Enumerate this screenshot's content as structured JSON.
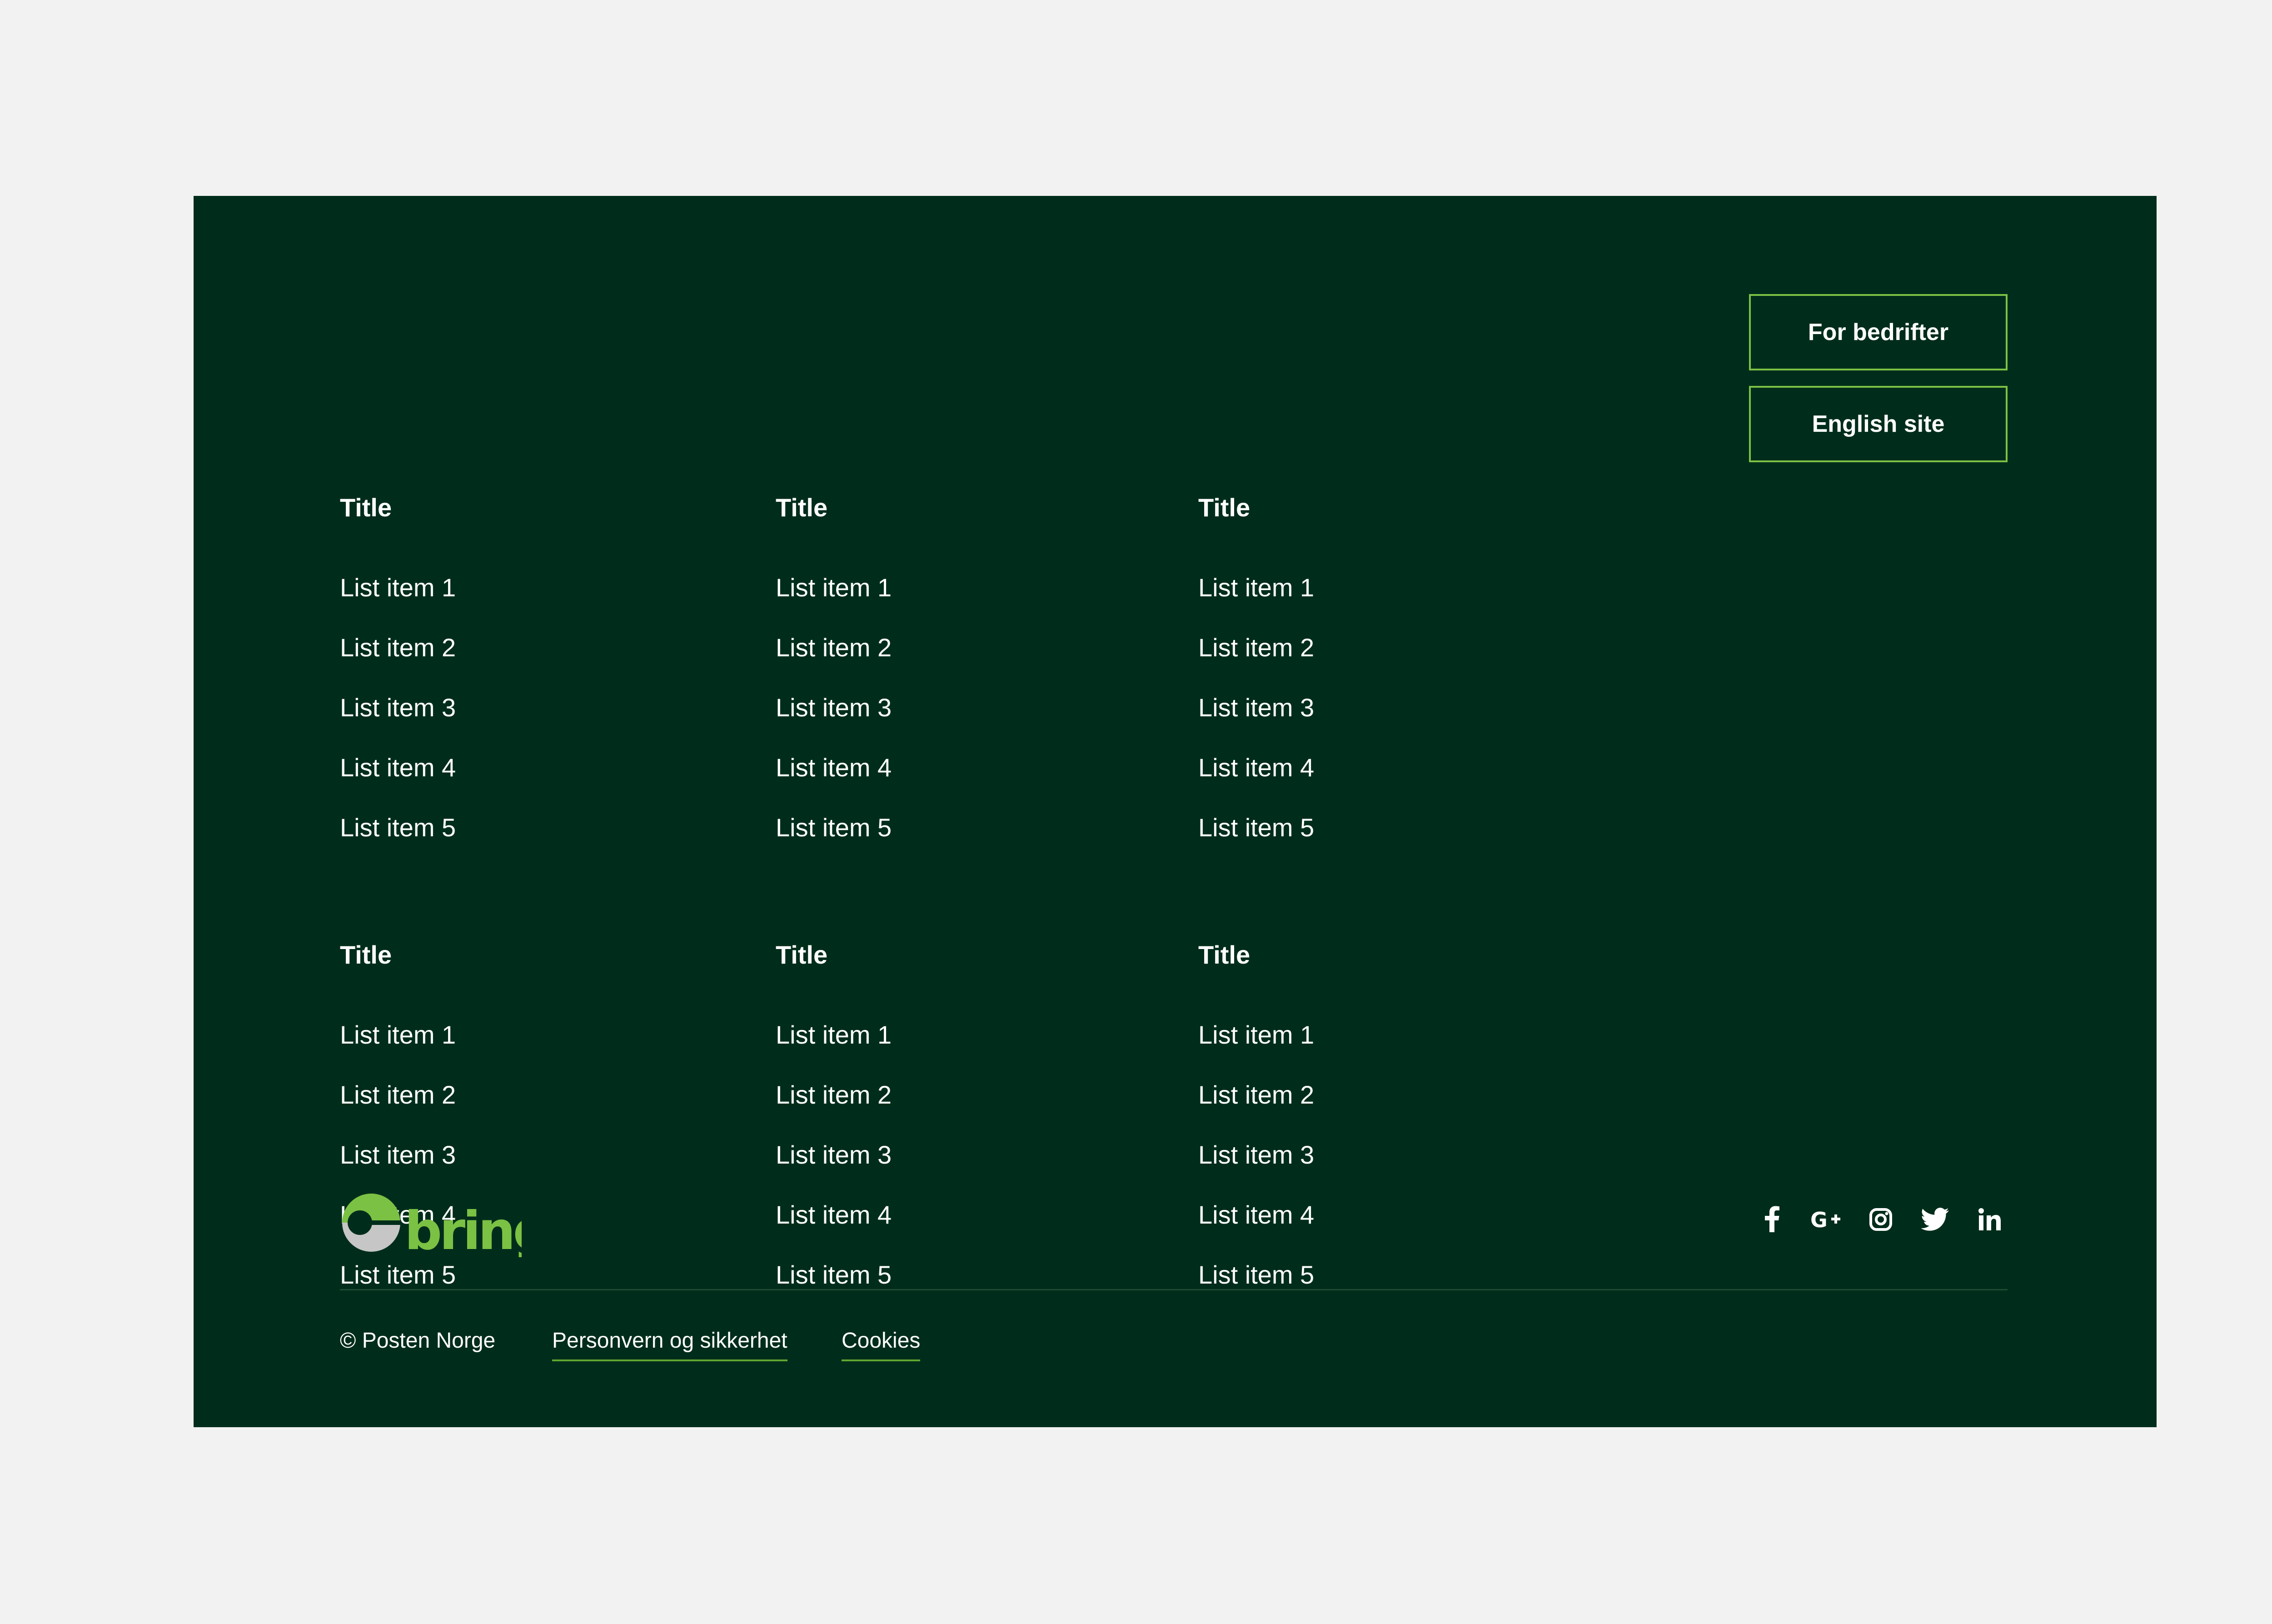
{
  "footer": {
    "sections": [
      {
        "columns": [
          {
            "title": "Title",
            "items": [
              "List item 1",
              "List item 2",
              "List item 3",
              "List item 4",
              "List item 5"
            ]
          },
          {
            "title": "Title",
            "items": [
              "List item 1",
              "List item 2",
              "List item 3",
              "List item 4",
              "List item 5"
            ]
          },
          {
            "title": "Title",
            "items": [
              "List item 1",
              "List item 2",
              "List item 3",
              "List item 4",
              "List item 5"
            ]
          }
        ]
      },
      {
        "columns": [
          {
            "title": "Title",
            "items": [
              "List item 1",
              "List item 2",
              "List item 3",
              "List item 4",
              "List item 5"
            ]
          },
          {
            "title": "Title",
            "items": [
              "List item 1",
              "List item 2",
              "List item 3",
              "List item 4",
              "List item 5"
            ]
          },
          {
            "title": "Title",
            "items": [
              "List item 1",
              "List item 2",
              "List item 3",
              "List item 4",
              "List item 5"
            ]
          }
        ]
      }
    ],
    "buttons": {
      "business_label": "For bedrifter",
      "english_label": "English site"
    },
    "logo": {
      "text": "bring",
      "icon": "bring-logo-icon"
    },
    "social": [
      {
        "name": "facebook-icon"
      },
      {
        "name": "google-plus-icon"
      },
      {
        "name": "instagram-icon"
      },
      {
        "name": "twitter-icon"
      },
      {
        "name": "linkedin-icon"
      }
    ],
    "bottom": {
      "copyright": "© Posten Norge",
      "privacy_link": "Personvern og sikkerhet",
      "cookies_link": "Cookies"
    },
    "colors": {
      "background": "#002d1b",
      "page": "#f2f2f2",
      "accent": "#7bc144",
      "text": "#ffffff"
    }
  }
}
